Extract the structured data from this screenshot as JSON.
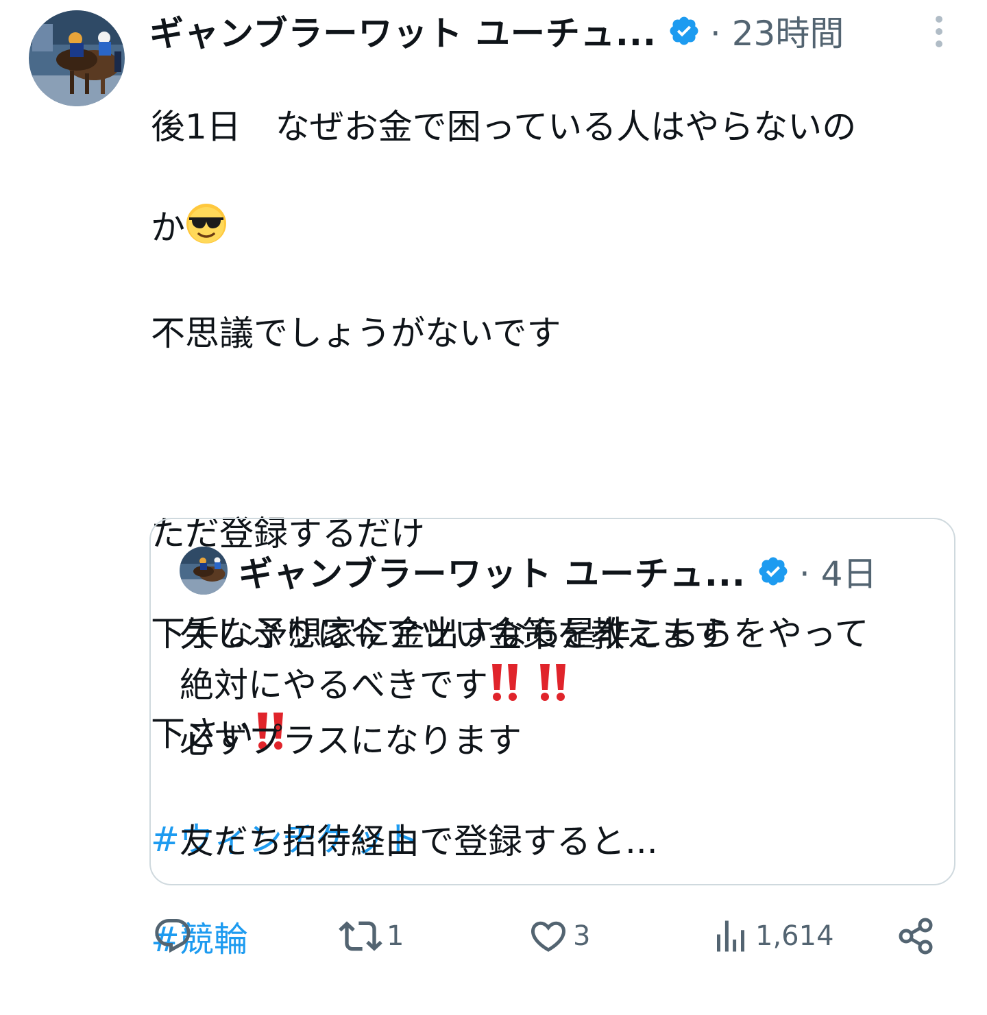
{
  "tweet": {
    "author_name": "ギャンブラーワット ユーチュ...",
    "verified_icon": "verified-badge-icon",
    "separator": "·",
    "time": "23時間",
    "more_icon": "more-vertical-icon",
    "lines": [
      "後1日　なぜお金で困っている人はやらないの",
      "か",
      "不思議でしょうがないです",
      "",
      "ただ登録するだけ",
      "下手な予想家に金出すなら是非こちらをやって",
      "下さい"
    ],
    "emoji_sunglasses": "smiling-face-with-sunglasses-emoji",
    "emoji_double_exclamation": "double-exclamation-emoji",
    "hashtags": [
      "#ウィンチケット",
      "#競輪"
    ]
  },
  "quote": {
    "author_name": "ギャンブラーワット ユーチュ...",
    "separator": "·",
    "time": "4日",
    "lines": [
      "久しぶりに今アツい金策を教えます",
      "絶対にやるべきです",
      "必ずプラスになります",
      "",
      "友だち招待経由で登録すると..."
    ]
  },
  "actions": {
    "reply": {
      "icon": "reply-icon",
      "count": ""
    },
    "retweet": {
      "icon": "retweet-icon",
      "count": "1"
    },
    "like": {
      "icon": "heart-icon",
      "count": "3"
    },
    "views": {
      "icon": "views-icon",
      "count": "1,614"
    },
    "share": {
      "icon": "share-icon"
    }
  },
  "colors": {
    "text": "#0f1419",
    "secondary": "#536471",
    "link": "#1d9bf0",
    "verified": "#1d9bf0",
    "border": "#cfd9de",
    "emoji_red": "#e0242b"
  }
}
